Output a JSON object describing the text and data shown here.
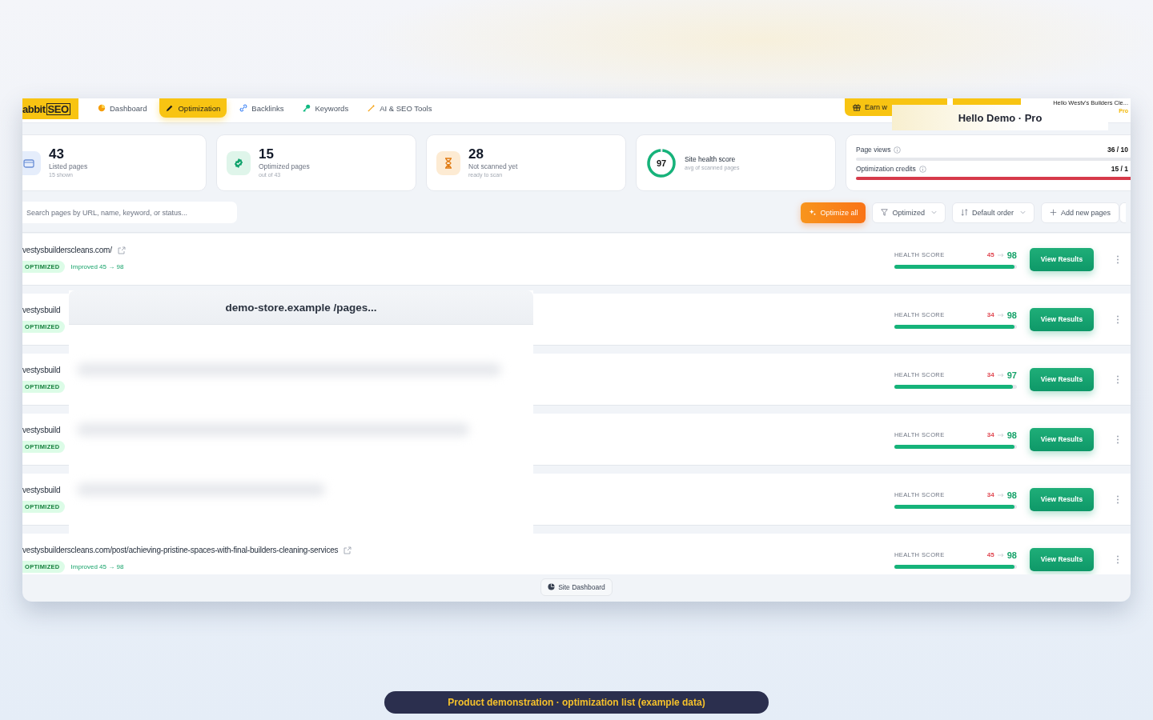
{
  "nav": {
    "logo": {
      "text": "abbit",
      "boxed": "SEO"
    },
    "items": [
      {
        "label": "Dashboard",
        "selected": false
      },
      {
        "label": "Optimization",
        "selected": true
      },
      {
        "label": "Backlinks",
        "selected": false
      },
      {
        "label": "Keywords",
        "selected": false
      },
      {
        "label": "AI & SEO Tools",
        "selected": false
      }
    ]
  },
  "header_right": {
    "earn_button": "Earn w",
    "account_name": "Hello Westy's Builders Cle...",
    "plan": "Pro"
  },
  "overlay_banner": "Hello Demo · Pro",
  "stats": [
    {
      "kind": "count",
      "value": "43",
      "label": "Listed pages",
      "sub": "15 shown"
    },
    {
      "kind": "count",
      "value": "15",
      "label": "Optimized pages",
      "sub": "out of 43"
    },
    {
      "kind": "count",
      "value": "28",
      "label": "Not scanned yet",
      "sub": "ready to scan"
    },
    {
      "kind": "score",
      "score": "97",
      "level": 0.97,
      "title": "Site health score",
      "sub": "avg of scanned pages"
    },
    {
      "kind": "usage",
      "meters": [
        {
          "label": "Page views",
          "reading": "36 / 10"
        },
        {
          "label": "Optimization credits",
          "reading": "15 / 1",
          "level": 1
        }
      ]
    }
  ],
  "toolbar": {
    "search": {
      "placeholder": "Search pages by URL, name, keyword, or status..."
    },
    "buttons": [
      {
        "kind": "primary",
        "label": "Optimize all"
      },
      {
        "kind": "dropdown",
        "label": "Optimized"
      },
      {
        "kind": "dropdown",
        "label": "Default order"
      },
      {
        "kind": "plain",
        "label": "Add new pages"
      }
    ]
  },
  "pages": [
    {
      "url": "vestysbuilderscleans.com/",
      "external": true,
      "status": "OPTIMIZED",
      "note": "Improved 45 → 98",
      "score_label": "HEALTH SCORE",
      "before": "45",
      "after": "98",
      "level": 0.98,
      "action": "View Results"
    },
    {
      "url": "vestysbuild",
      "external": false,
      "status": "OPTIMIZED",
      "score_label": "HEALTH SCORE",
      "before": "34",
      "after": "98",
      "level": 0.98,
      "action": "View Results"
    },
    {
      "url": "vestysbuild",
      "external": false,
      "status": "OPTIMIZED",
      "score_label": "HEALTH SCORE",
      "before": "34",
      "after": "97",
      "level": 0.97,
      "action": "View Results"
    },
    {
      "url": "vestysbuild",
      "external": false,
      "status": "OPTIMIZED",
      "score_label": "HEALTH SCORE",
      "before": "34",
      "after": "98",
      "level": 0.98,
      "action": "View Results"
    },
    {
      "url": "vestysbuild",
      "external": false,
      "status": "OPTIMIZED",
      "score_label": "HEALTH SCORE",
      "before": "34",
      "after": "98",
      "level": 0.98,
      "action": "View Results"
    },
    {
      "url": "vestysbuilderscleans.com/post/achieving-pristine-spaces-with-final-builders-cleaning-services",
      "external": true,
      "status": "OPTIMIZED",
      "note": "Improved 45 → 98",
      "score_label": "HEALTH SCORE",
      "before": "45",
      "after": "98",
      "level": 0.98,
      "action": "View Results"
    }
  ],
  "preview_panel": {
    "title": "demo-store.example /pages..."
  },
  "footer_button": "Site Dashboard",
  "caption": "Product demonstration · optimization list (example data)"
}
